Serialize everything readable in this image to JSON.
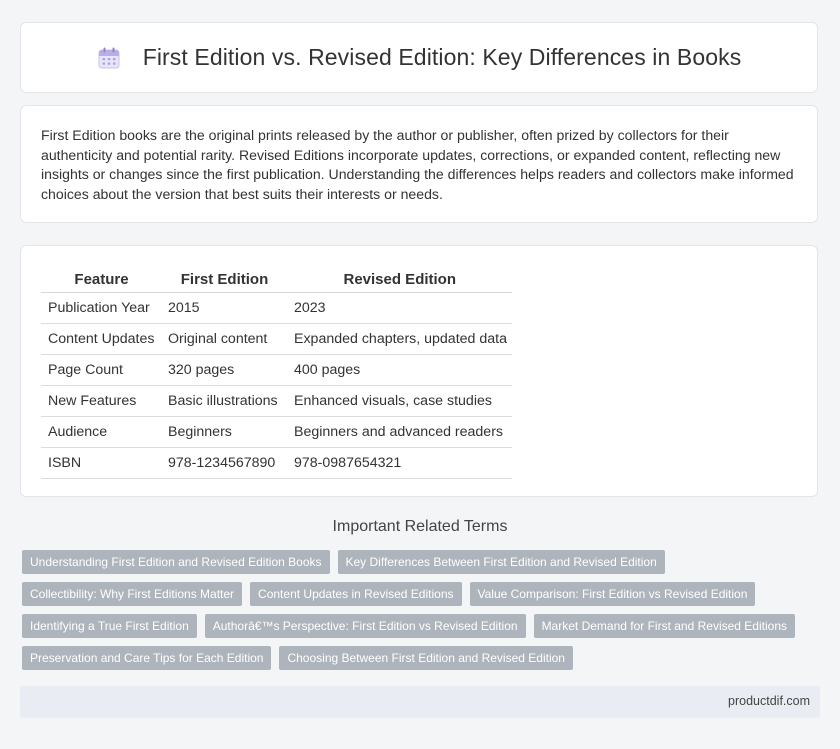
{
  "header": {
    "title": "First Edition vs. Revised Edition: Key Differences in Books",
    "icon": "calendar-icon"
  },
  "intro": {
    "text": "First Edition books are the original prints released by the author or publisher, often prized by collectors for their authenticity and potential rarity. Revised Editions incorporate updates, corrections, or expanded content, reflecting new insights or changes since the first publication. Understanding the differences helps readers and collectors make informed choices about the version that best suits their interests or needs."
  },
  "table": {
    "headers": [
      "Feature",
      "First Edition",
      "Revised Edition"
    ],
    "rows": [
      [
        "Publication Year",
        "2015",
        "2023"
      ],
      [
        "Content Updates",
        "Original content",
        "Expanded chapters, updated data"
      ],
      [
        "Page Count",
        "320 pages",
        "400 pages"
      ],
      [
        "New Features",
        "Basic illustrations",
        "Enhanced visuals, case studies"
      ],
      [
        "Audience",
        "Beginners",
        "Beginners and advanced readers"
      ],
      [
        "ISBN",
        "978-1234567890",
        "978-0987654321"
      ]
    ]
  },
  "related": {
    "title": "Important Related Terms",
    "tags": [
      "Understanding First Edition and Revised Edition Books",
      "Key Differences Between First Edition and Revised Edition",
      "Collectibility: Why First Editions Matter",
      "Content Updates in Revised Editions",
      "Value Comparison: First Edition vs Revised Edition",
      "Identifying a True First Edition",
      "Authorâ€™s Perspective: First Edition vs Revised Edition",
      "Market Demand for First and Revised Editions",
      "Preservation and Care Tips for Each Edition",
      "Choosing Between First Edition and Revised Edition"
    ]
  },
  "footer": {
    "site": "productdif.com"
  },
  "colors": {
    "tag_bg": "#aeb4bc",
    "footer_bg": "#e9edf3",
    "page_bg": "#f4f5f7"
  }
}
